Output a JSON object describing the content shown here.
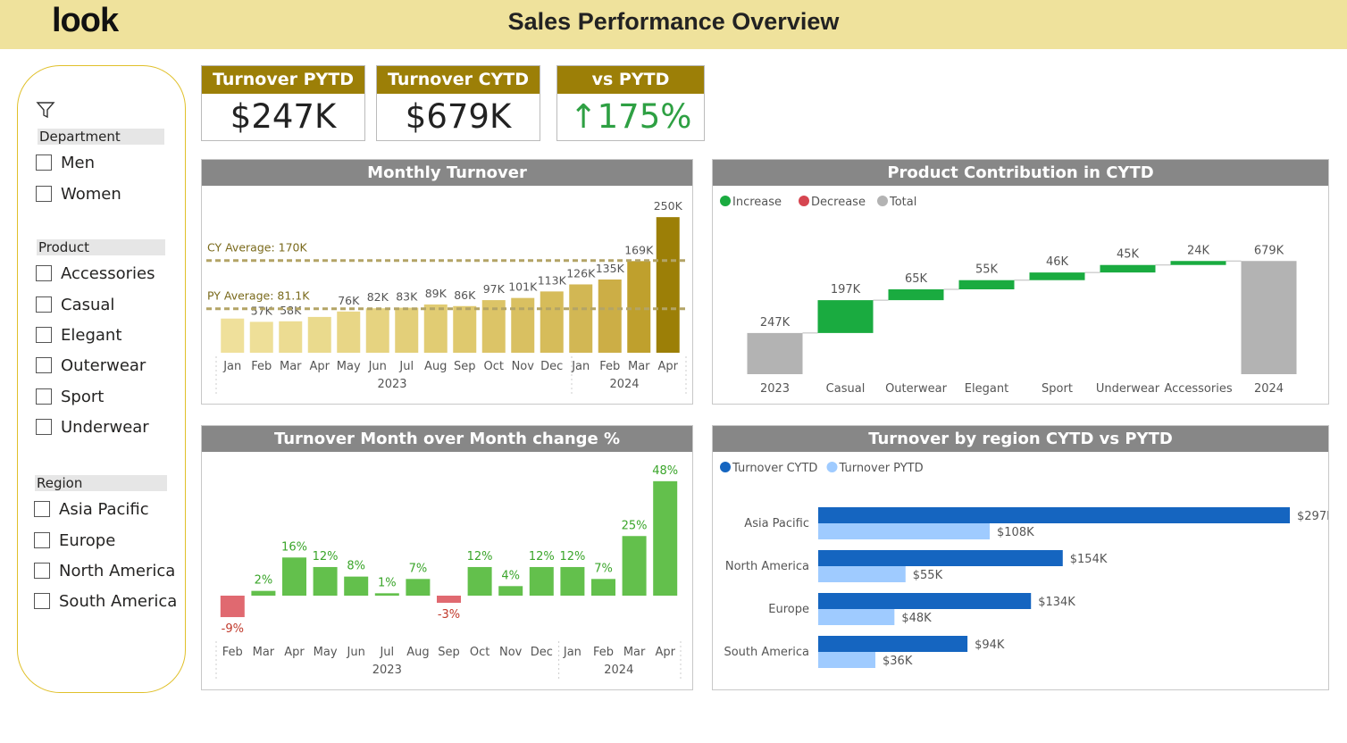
{
  "header": {
    "logo": "look",
    "title": "Sales Performance Overview"
  },
  "filters": {
    "department": {
      "label": "Department",
      "options": [
        "Men",
        "Women"
      ]
    },
    "product": {
      "label": "Product",
      "options": [
        "Accessories",
        "Casual",
        "Elegant",
        "Outerwear",
        "Sport",
        "Underwear"
      ]
    },
    "region": {
      "label": "Region",
      "options": [
        "Asia Pacific",
        "Europe",
        "North America",
        "South America"
      ]
    }
  },
  "kpis": {
    "pytd": {
      "label": "Turnover PYTD",
      "value": "$247K"
    },
    "cytd": {
      "label": "Turnover CYTD",
      "value": "$679K"
    },
    "vs": {
      "label": "vs PYTD",
      "value": "↑175%"
    }
  },
  "colors": {
    "accent": "#9c7f07",
    "header_bg": "#efe29c",
    "panel_header": "#878787",
    "increase": "#1aab40",
    "decrease": "#d64550",
    "total": "#b3b3b3",
    "cytd": "#1565c0",
    "pytd": "#9fcbff",
    "mom_pos": "#63c04c",
    "mom_neg": "#e06970"
  },
  "chart_data": [
    {
      "id": "monthly",
      "type": "bar",
      "title": "Monthly Turnover",
      "categories": [
        "Jan",
        "Feb",
        "Mar",
        "Apr",
        "May",
        "Jun",
        "Jul",
        "Aug",
        "Sep",
        "Oct",
        "Nov",
        "Dec",
        "Jan",
        "Feb",
        "Mar",
        "Apr"
      ],
      "groups": [
        "2023",
        "2024"
      ],
      "values": [
        63,
        57,
        58,
        66,
        76,
        82,
        83,
        89,
        86,
        97,
        101,
        113,
        126,
        135,
        169,
        250
      ],
      "labels": [
        "",
        "57K",
        "58K",
        "",
        "76K",
        "82K",
        "83K",
        "89K",
        "86K",
        "97K",
        "101K",
        "113K",
        "126K",
        "135K",
        "169K",
        "250K"
      ],
      "reference_lines": [
        {
          "label": "CY Average: 170K",
          "value": 170
        },
        {
          "label": "PY Average: 81.1K",
          "value": 81.1
        }
      ],
      "ylim": [
        0,
        270
      ]
    },
    {
      "id": "waterfall",
      "type": "bar",
      "title": "Product Contribution in CYTD",
      "legend": [
        "Increase",
        "Decrease",
        "Total"
      ],
      "categories": [
        "2023",
        "Casual",
        "Outerwear",
        "Elegant",
        "Sport",
        "Underwear",
        "Accessories",
        "2024"
      ],
      "values": [
        247,
        197,
        65,
        55,
        46,
        45,
        24,
        679
      ],
      "kinds": [
        "total",
        "increase",
        "increase",
        "increase",
        "increase",
        "increase",
        "increase",
        "total"
      ],
      "labels": [
        "247K",
        "197K",
        "65K",
        "55K",
        "46K",
        "45K",
        "24K",
        "679K"
      ],
      "ylim": [
        0,
        750
      ]
    },
    {
      "id": "mom",
      "type": "bar",
      "title": "Turnover Month over Month change %",
      "categories": [
        "Feb",
        "Mar",
        "Apr",
        "May",
        "Jun",
        "Jul",
        "Aug",
        "Sep",
        "Oct",
        "Nov",
        "Dec",
        "Jan",
        "Feb",
        "Mar",
        "Apr"
      ],
      "groups": [
        "2023",
        "2024"
      ],
      "values": [
        -9,
        2,
        16,
        12,
        8,
        1,
        7,
        -3,
        12,
        4,
        12,
        12,
        7,
        25,
        48
      ],
      "labels": [
        "-9%",
        "2%",
        "16%",
        "12%",
        "8%",
        "1%",
        "7%",
        "-3%",
        "12%",
        "4%",
        "12%",
        "12%",
        "7%",
        "25%",
        "48%"
      ]
    },
    {
      "id": "region",
      "type": "bar",
      "title": "Turnover by region CYTD vs PYTD",
      "legend": [
        "Turnover CYTD",
        "Turnover PYTD"
      ],
      "categories": [
        "Asia Pacific",
        "North America",
        "Europe",
        "South America"
      ],
      "series": [
        {
          "name": "Turnover CYTD",
          "values": [
            297,
            154,
            134,
            94
          ],
          "labels": [
            "$297K",
            "$154K",
            "$134K",
            "$94K"
          ]
        },
        {
          "name": "Turnover PYTD",
          "values": [
            108,
            55,
            48,
            36
          ],
          "labels": [
            "$108K",
            "$55K",
            "$48K",
            "$36K"
          ]
        }
      ],
      "xlim": [
        0,
        297
      ]
    }
  ]
}
